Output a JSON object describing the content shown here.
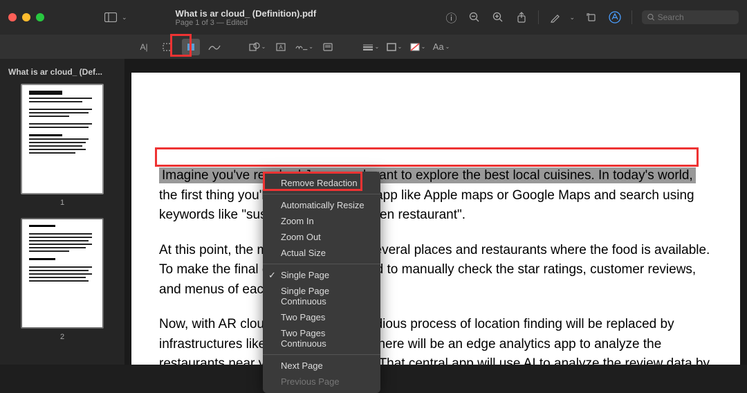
{
  "window": {
    "title": "What is ar cloud_ (Definition).pdf",
    "subtitle": "Page 1 of 3 — Edited"
  },
  "sidebar": {
    "title": "What is ar cloud_ (Def...",
    "thumbs": [
      {
        "num": "1"
      },
      {
        "num": "2"
      }
    ]
  },
  "search": {
    "placeholder": "Search"
  },
  "document": {
    "redacted_line": "Imagine you've reached Japan and want to explore the best local cuisines. In today's world,",
    "para1_rest": "the first thing you'll do is open a map app like Apple maps or Google Maps and search using keywords like \"sushi near me\" or \"ramen restaurant\".",
    "para2": "At this point, the map app will show several places and restaurants where the food is available. To make the final choice, you will need to manually check the star ratings, customer reviews, and menus of each option.",
    "para3": "Now, with AR cloud coming in, that tedious process of location finding will be replaced by infrastructures like edge computing. There will be an edge analytics app to analyze the restaurants near you in the AR cloud. That central app will use AI to analyze the review data by other users and suggest you the best ones."
  },
  "context_menu": {
    "remove_redaction": "Remove Redaction",
    "auto_resize": "Automatically Resize",
    "zoom_in": "Zoom In",
    "zoom_out": "Zoom Out",
    "actual_size": "Actual Size",
    "single_page": "Single Page",
    "single_page_cont": "Single Page Continuous",
    "two_pages": "Two Pages",
    "two_pages_cont": "Two Pages Continuous",
    "next_page": "Next Page",
    "prev_page": "Previous Page"
  },
  "secondary_toolbar": {
    "aa": "Aa"
  }
}
